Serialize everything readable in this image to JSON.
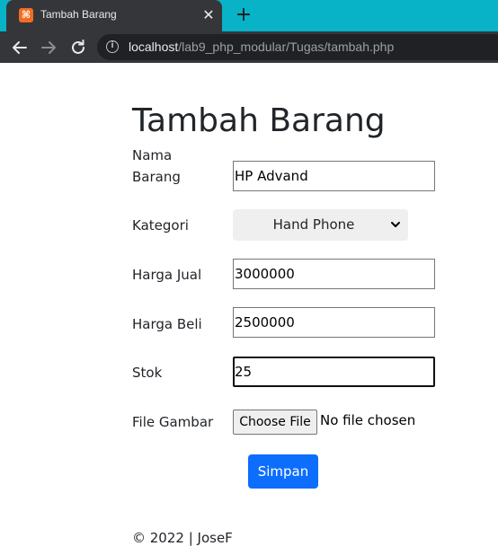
{
  "browser": {
    "tab_title": "Tambah Barang",
    "favicon_glyph": "⌘",
    "close_glyph": "✕",
    "new_tab_glyph": "+",
    "url_host": "localhost",
    "url_path": "/lab9_php_modular/Tugas/tambah.php",
    "icons": [
      "back-arrow-icon",
      "forward-arrow-icon",
      "reload-icon",
      "info-icon"
    ],
    "tab_color": "#35363a",
    "tabbar_color": "#08b3c8"
  },
  "page": {
    "heading": "Tambah Barang",
    "form": {
      "nama_label_line1": "Nama",
      "nama_label_line2": "Barang",
      "nama_value": "HP Advand",
      "kategori_label": "Kategori",
      "kategori_selected": "Hand Phone",
      "harga_jual_label": "Harga Jual",
      "harga_jual_value": "3000000",
      "harga_beli_label": "Harga Beli",
      "harga_beli_value": "2500000",
      "stok_label": "Stok",
      "stok_value": "25",
      "gambar_label": "File Gambar",
      "choose_file_label": "Choose File",
      "file_status": "No file chosen",
      "submit_label": "Simpan"
    },
    "footer": "© 2022 | JoseF",
    "accent_color": "#0d6efd"
  }
}
